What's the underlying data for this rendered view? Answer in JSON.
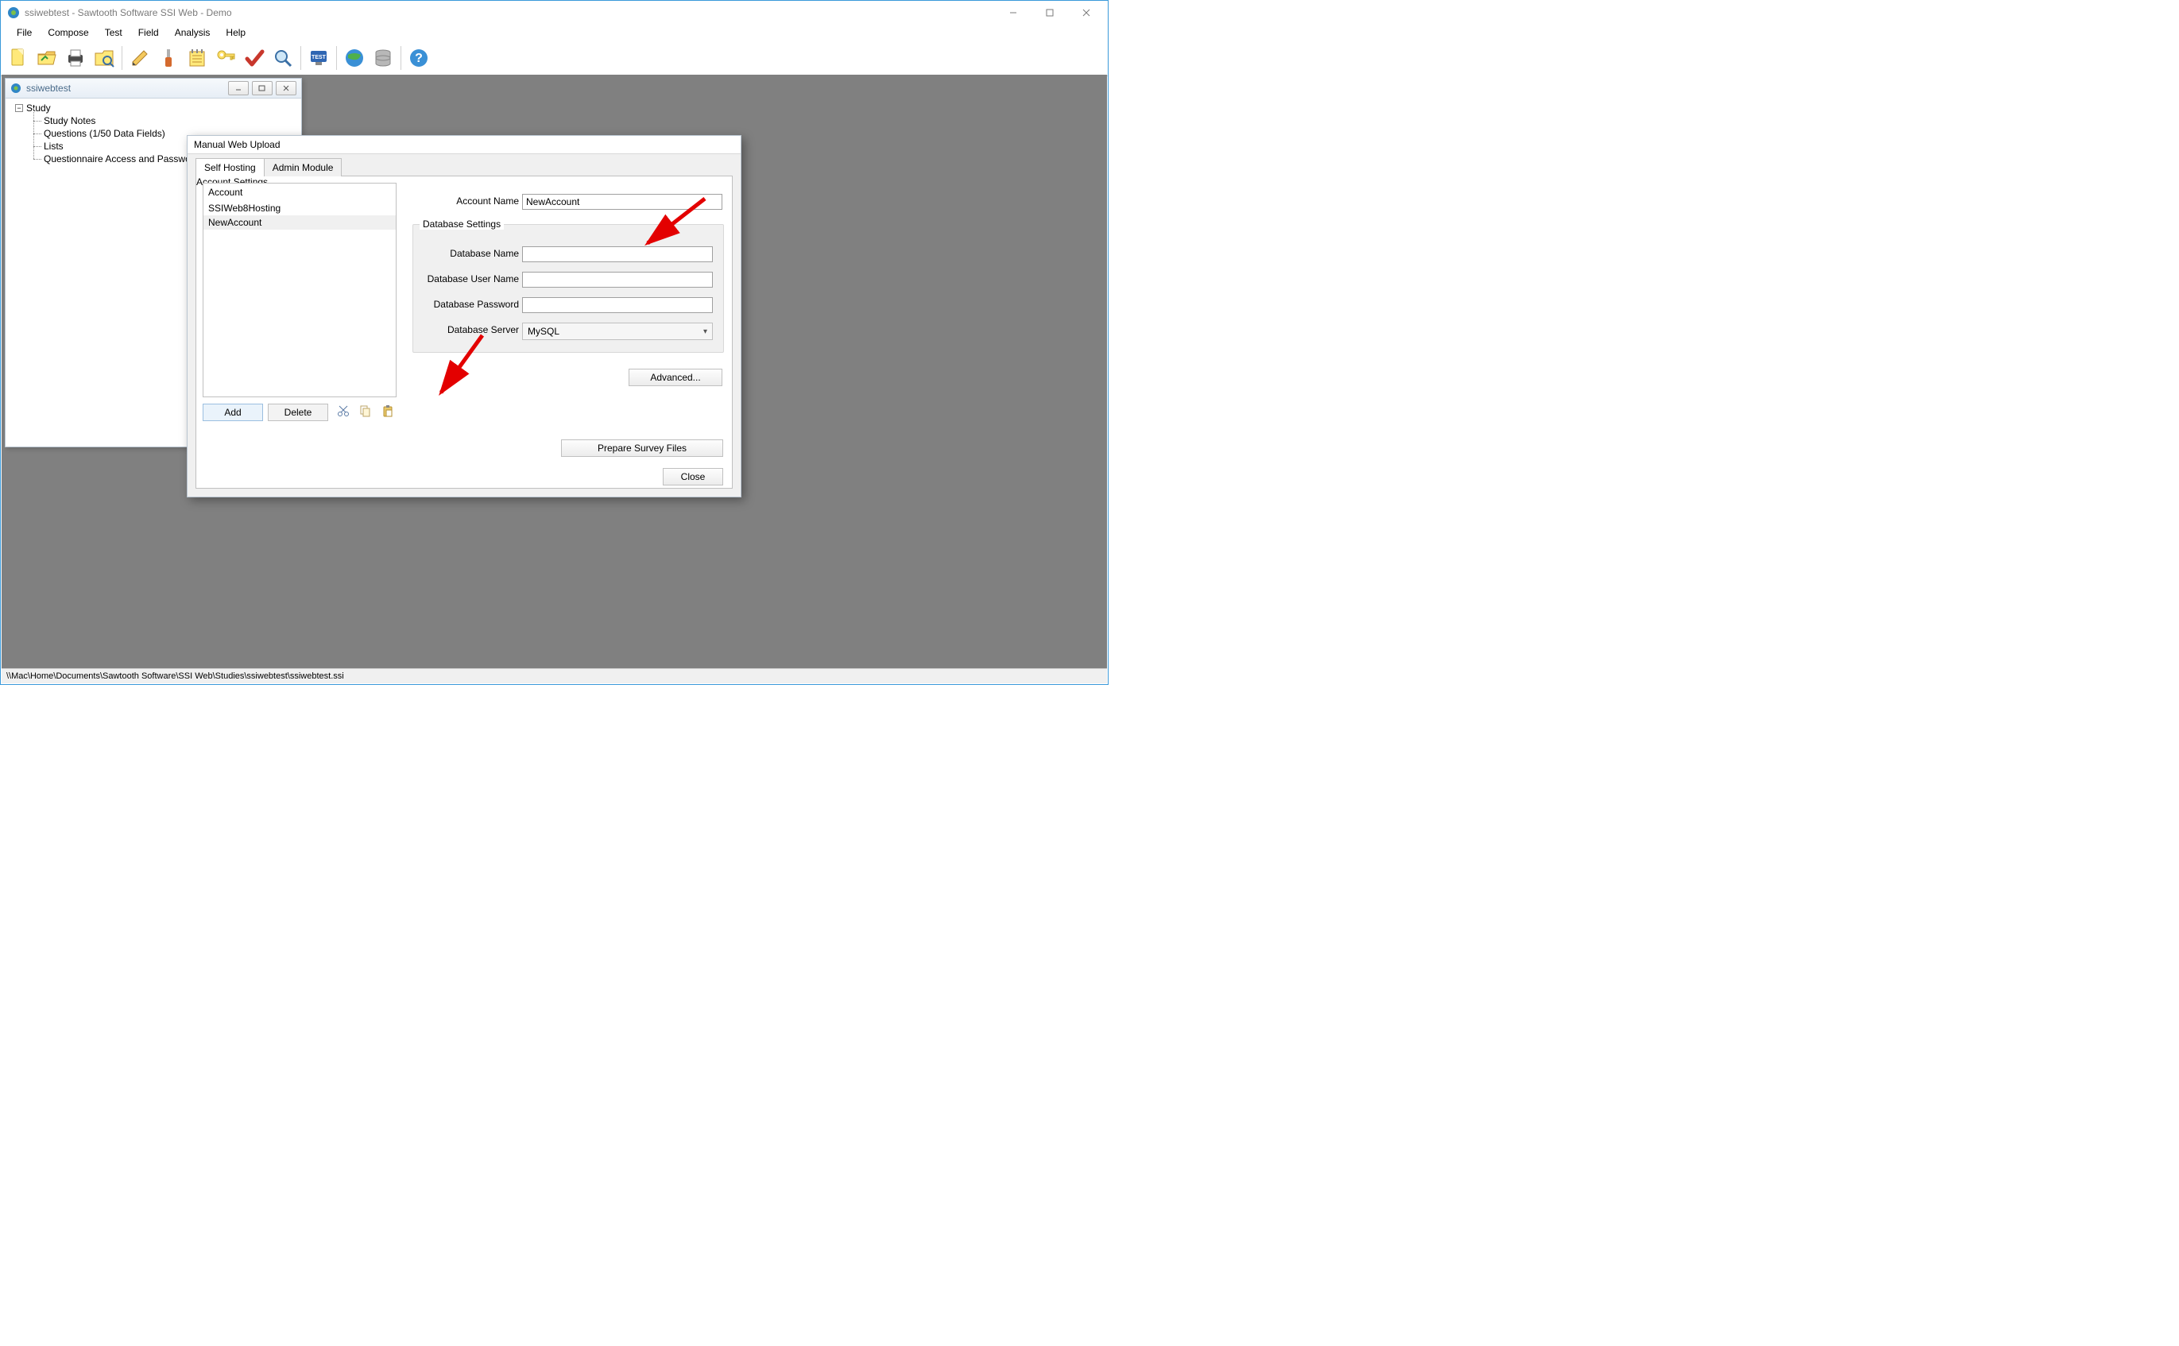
{
  "titleBar": {
    "text": "ssiwebtest - Sawtooth Software SSI Web - Demo"
  },
  "windowControls": {
    "min": "",
    "max": "",
    "close": ""
  },
  "menubar": [
    "File",
    "Compose",
    "Test",
    "Field",
    "Analysis",
    "Help"
  ],
  "toolbarIcons": [
    "new-file-icon",
    "open-folder-icon",
    "print-icon",
    "browse-icon",
    "sep",
    "pencil-icon",
    "screwdriver-icon",
    "notes-icon",
    "key-icon",
    "checkmark-icon",
    "magnifier-icon",
    "sep",
    "test-icon",
    "sep",
    "globe-icon",
    "database-icon",
    "sep",
    "help-icon"
  ],
  "treeWindow": {
    "title": "ssiwebtest",
    "root": "Study",
    "items": [
      "Study Notes",
      "Questions (1/50 Data Fields)",
      "Lists",
      "Questionnaire Access and Passwords"
    ]
  },
  "dialog": {
    "title": "Manual Web Upload",
    "tabs": [
      "Self Hosting",
      "Admin Module"
    ],
    "accountHeader": "Account",
    "accounts": [
      "SSIWeb8Hosting",
      "NewAccount"
    ],
    "selectedAccountIndex": 1,
    "addLabel": "Add",
    "deleteLabel": "Delete",
    "accountSettingsLegend": "Account Settings",
    "accountNameLabel": "Account Name",
    "accountNameValue": "NewAccount",
    "dbSettingsLegend": "Database Settings",
    "dbNameLabel": "Database Name",
    "dbNameValue": "",
    "dbUserLabel": "Database User Name",
    "dbUserValue": "",
    "dbPassLabel": "Database Password",
    "dbPassValue": "",
    "dbServerLabel": "Database Server",
    "dbServerValue": "MySQL",
    "advancedLabel": "Advanced...",
    "prepareLabel": "Prepare Survey Files",
    "closeLabel": "Close"
  },
  "statusbar": "\\\\Mac\\Home\\Documents\\Sawtooth Software\\SSI Web\\Studies\\ssiwebtest\\ssiwebtest.ssi"
}
